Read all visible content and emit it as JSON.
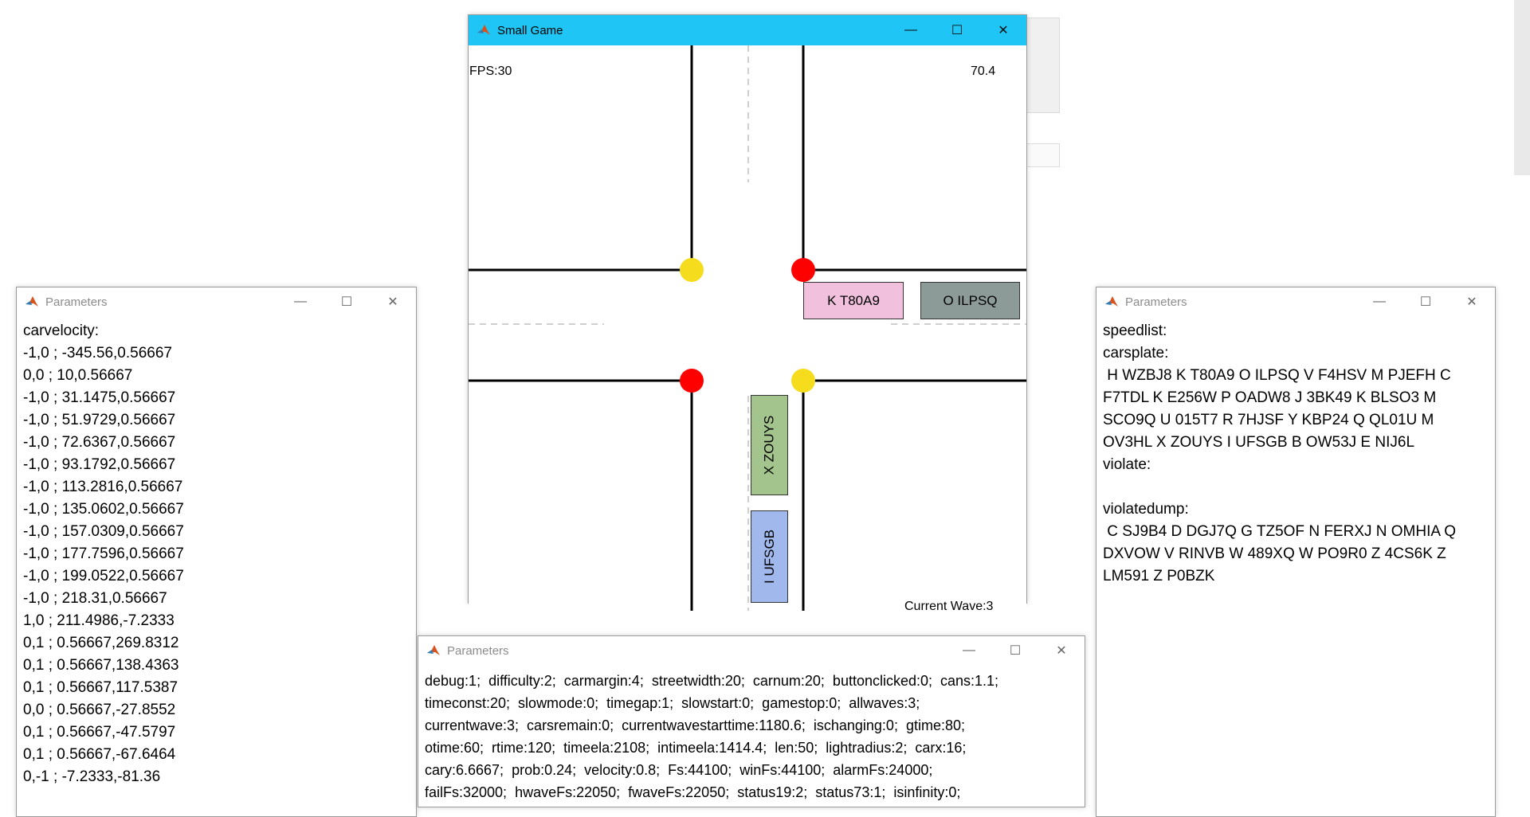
{
  "game_window": {
    "title": "Small Game",
    "fps_label": "FPS:30",
    "top_right_value": "70.4",
    "wave_label": "Current Wave:3",
    "cars": [
      {
        "plate": "K T80A9",
        "color": "#f0c0dd"
      },
      {
        "plate": "O ILPSQ",
        "color": "#8c9a98"
      },
      {
        "plate": "X ZOUYS",
        "color": "#a3c48d"
      },
      {
        "plate": "I UFSGB",
        "color": "#a0b8ec"
      }
    ],
    "lights": {
      "top_left": "#f5dd1e",
      "top_right": "#ff0000",
      "bottom_left": "#ff0000",
      "bottom_right": "#f5dd1e"
    }
  },
  "param_window_left": {
    "title": "Parameters",
    "lines": [
      "carvelocity:",
      "-1,0 ; -345.56,0.56667",
      "0,0 ; 10,0.56667",
      "-1,0 ; 31.1475,0.56667",
      "-1,0 ; 51.9729,0.56667",
      "-1,0 ; 72.6367,0.56667",
      "-1,0 ; 93.1792,0.56667",
      "-1,0 ; 113.2816,0.56667",
      "-1,0 ; 135.0602,0.56667",
      "-1,0 ; 157.0309,0.56667",
      "-1,0 ; 177.7596,0.56667",
      "-1,0 ; 199.0522,0.56667",
      "-1,0 ; 218.31,0.56667",
      "1,0 ; 211.4986,-7.2333",
      "0,1 ; 0.56667,269.8312",
      "0,1 ; 0.56667,138.4363",
      "0,1 ; 0.56667,117.5387",
      "0,0 ; 0.56667,-27.8552",
      "0,1 ; 0.56667,-47.5797",
      "0,1 ; 0.56667,-67.6464",
      "0,-1 ; -7.2333,-81.36"
    ]
  },
  "param_window_right": {
    "title": "Parameters",
    "lines": [
      "speedlist:",
      "carsplate:",
      " H WZBJ8 K T80A9 O ILPSQ V F4HSV M PJEFH C",
      "F7TDL K E256W P OADW8 J 3BK49 K BLSO3 M",
      "SCO9Q U 015T7 R 7HJSF Y KBP24 Q QL01U M",
      "OV3HL X ZOUYS I UFSGB B OW53J E NIJ6L",
      "violate:",
      "",
      "violatedump:",
      " C SJ9B4 D DGJ7Q G TZ5OF N FERXJ N OMHIA Q",
      "DXVOW V RINVB W 489XQ W PO9R0 Z 4CS6K Z",
      "LM591 Z P0BZK"
    ]
  },
  "param_window_bottom": {
    "title": "Parameters",
    "lines": [
      "debug:1;  difficulty:2;  carmargin:4;  streetwidth:20;  carnum:20;  buttonclicked:0;  cans:1.1;",
      "timeconst:20;  slowmode:0;  timegap:1;  slowstart:0;  gamestop:0;  allwaves:3;",
      "currentwave:3;  carsremain:0;  currentwavestarttime:1180.6;  ischanging:0;  gtime:80;",
      "otime:60;  rtime:120;  timeela:2108;  intimeela:1414.4;  len:50;  lightradius:2;  carx:16;",
      "cary:6.6667;  prob:0.24;  velocity:0.8;  Fs:44100;  winFs:44100;  alarmFs:24000;",
      "failFs:32000;  hwaveFs:22050;  fwaveFs:22050;  status19:2;  status73:1;  isinfinity:0;"
    ]
  },
  "window_controls": {
    "minimize": "—",
    "maximize": "☐",
    "close": "✕"
  }
}
